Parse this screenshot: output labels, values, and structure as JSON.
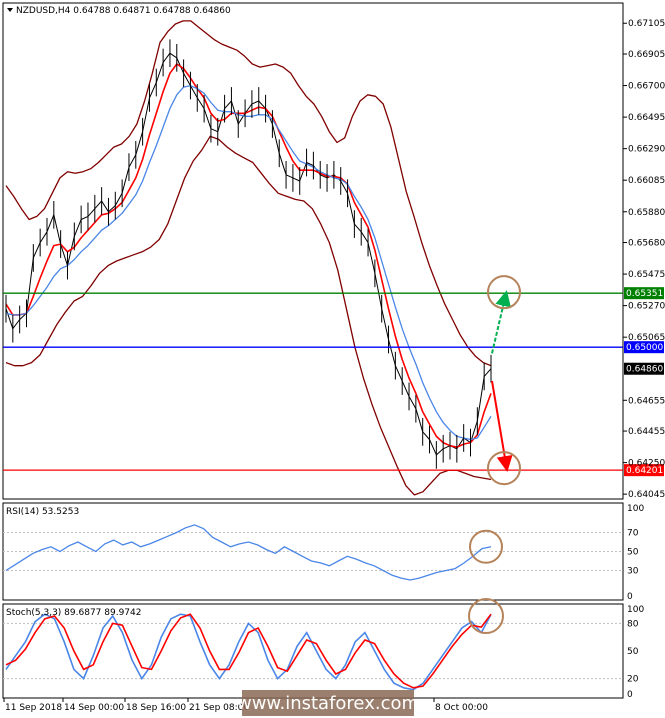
{
  "header": {
    "main": "NZDUSD,H4  0.64788 0.64871 0.64788 0.64860",
    "rsi": "RSI(14) 53.5253",
    "stoch": "Stoch(5,3,3) 89.6877 89.9742"
  },
  "watermark": "www.instaforex.com",
  "colors": {
    "price": "#000000",
    "bollinger": "#800000",
    "fast_ma": "#ff0000",
    "slow_ma": "#4a86e8",
    "level_high": "#008000",
    "level_mid": "#0000ff",
    "level_low": "#ff0000",
    "marker": "#b5835a",
    "arrow_up": "#00b050",
    "arrow_down": "#ff0000",
    "rsi_line": "#4a86e8",
    "stoch_main": "#4a86e8",
    "stoch_signal": "#ff0000"
  },
  "chart_data": [
    {
      "type": "line",
      "panel": "price",
      "symbol": "NZDUSD",
      "timeframe": "H4",
      "ylim": [
        0.6402,
        0.6723
      ],
      "y_ticks": [
        "0.67105",
        "0.66905",
        "0.66700",
        "0.66495",
        "0.66290",
        "0.66085",
        "0.65880",
        "0.65680",
        "0.65475",
        "0.65270",
        "0.65065",
        "0.64655",
        "0.64455",
        "0.64250",
        "0.64045"
      ],
      "x_ticks": [
        "11 Sep 2018",
        "14 Sep 00:00",
        "18 Sep 16:00",
        "21 Sep 08:00",
        "8 Oct 00:00"
      ],
      "levels": [
        {
          "name": "green",
          "value": 0.65351,
          "label": "0.65351"
        },
        {
          "name": "blue",
          "value": 0.65,
          "label": "0.65000"
        },
        {
          "name": "red",
          "value": 0.64201,
          "label": "0.64201"
        }
      ],
      "last_price": {
        "value": 0.6486,
        "label": "0.64860"
      },
      "series": [
        {
          "name": "price",
          "values": [
            0.6525,
            0.6512,
            0.6518,
            0.6522,
            0.6558,
            0.6568,
            0.6575,
            0.6586,
            0.6567,
            0.6553,
            0.6572,
            0.6583,
            0.6585,
            0.659,
            0.6595,
            0.6588,
            0.6592,
            0.66,
            0.6617,
            0.6625,
            0.664,
            0.6662,
            0.6672,
            0.6685,
            0.6691,
            0.6688,
            0.6678,
            0.667,
            0.6662,
            0.6655,
            0.6642,
            0.664,
            0.6655,
            0.666,
            0.6645,
            0.6652,
            0.6658,
            0.666,
            0.6655,
            0.6645,
            0.6626,
            0.6612,
            0.661,
            0.6608,
            0.662,
            0.6618,
            0.6612,
            0.661,
            0.6612,
            0.6608,
            0.66,
            0.658,
            0.6575,
            0.6568,
            0.6548,
            0.6525,
            0.6505,
            0.6488,
            0.6478,
            0.6468,
            0.646,
            0.6445,
            0.644,
            0.643,
            0.6434,
            0.6436,
            0.6434,
            0.6441,
            0.6438,
            0.6452,
            0.6481,
            0.6486
          ]
        },
        {
          "name": "fast_ma",
          "values": [
            0.6528,
            0.6521,
            0.6521,
            0.6522,
            0.6533,
            0.6545,
            0.6556,
            0.6566,
            0.6567,
            0.6562,
            0.6565,
            0.6571,
            0.6576,
            0.6581,
            0.6586,
            0.6587,
            0.659,
            0.6594,
            0.6602,
            0.661,
            0.6622,
            0.6638,
            0.6652,
            0.6666,
            0.6678,
            0.6684,
            0.6681,
            0.6675,
            0.6668,
            0.6662,
            0.6652,
            0.6647,
            0.6648,
            0.6652,
            0.6652,
            0.6652,
            0.6654,
            0.6656,
            0.6655,
            0.665,
            0.664,
            0.663,
            0.6621,
            0.6615,
            0.6615,
            0.6615,
            0.6613,
            0.6611,
            0.6611,
            0.661,
            0.6606,
            0.6594,
            0.6586,
            0.6578,
            0.6563,
            0.6544,
            0.6525,
            0.6507,
            0.6492,
            0.648,
            0.647,
            0.6458,
            0.645,
            0.6442,
            0.6438,
            0.6436,
            0.6435,
            0.6437,
            0.6438,
            0.6443,
            0.6458,
            0.647
          ]
        },
        {
          "name": "slow_ma",
          "values": [
            0.6522,
            0.6521,
            0.6521,
            0.6522,
            0.6527,
            0.6533,
            0.6539,
            0.6546,
            0.6551,
            0.6553,
            0.6557,
            0.6562,
            0.6566,
            0.6571,
            0.6576,
            0.6579,
            0.6583,
            0.6587,
            0.6593,
            0.6599,
            0.6608,
            0.662,
            0.6631,
            0.6643,
            0.6655,
            0.6664,
            0.6669,
            0.667,
            0.6668,
            0.6665,
            0.6659,
            0.6654,
            0.6653,
            0.6653,
            0.6651,
            0.665,
            0.665,
            0.6651,
            0.6651,
            0.6648,
            0.6641,
            0.6634,
            0.6627,
            0.6621,
            0.6619,
            0.6617,
            0.6614,
            0.6612,
            0.661,
            0.6609,
            0.6606,
            0.6598,
            0.6591,
            0.6583,
            0.6571,
            0.6556,
            0.6541,
            0.6526,
            0.6512,
            0.65,
            0.6489,
            0.6477,
            0.6467,
            0.6458,
            0.6451,
            0.6446,
            0.6442,
            0.6441,
            0.644,
            0.6441,
            0.6448,
            0.6455
          ]
        },
        {
          "name": "bollinger_upper",
          "values": [
            0.6605,
            0.6598,
            0.659,
            0.6583,
            0.6585,
            0.659,
            0.66,
            0.661,
            0.6614,
            0.6613,
            0.6614,
            0.6616,
            0.662,
            0.6625,
            0.663,
            0.6632,
            0.6637,
            0.6645,
            0.666,
            0.6678,
            0.6698,
            0.6705,
            0.671,
            0.6712,
            0.6712,
            0.6708,
            0.6704,
            0.67,
            0.6697,
            0.6695,
            0.6693,
            0.6689,
            0.6684,
            0.6682,
            0.6683,
            0.6684,
            0.6682,
            0.6678,
            0.667,
            0.6663,
            0.6658,
            0.665,
            0.664,
            0.6633,
            0.6636,
            0.665,
            0.666,
            0.6664,
            0.6663,
            0.6658,
            0.6643,
            0.6622,
            0.6601,
            0.6585,
            0.6568,
            0.6553,
            0.654,
            0.6528,
            0.6518,
            0.6508,
            0.65,
            0.6494,
            0.649,
            0.6488
          ]
        },
        {
          "name": "bollinger_lower",
          "values": [
            0.649,
            0.6488,
            0.6488,
            0.649,
            0.6495,
            0.6505,
            0.6515,
            0.6523,
            0.653,
            0.6533,
            0.654,
            0.6548,
            0.6553,
            0.6556,
            0.6558,
            0.656,
            0.6562,
            0.6565,
            0.657,
            0.658,
            0.6595,
            0.661,
            0.6621,
            0.6628,
            0.6637,
            0.6635,
            0.663,
            0.6626,
            0.6623,
            0.662,
            0.6613,
            0.6606,
            0.66,
            0.6598,
            0.6596,
            0.6595,
            0.659,
            0.658,
            0.6568,
            0.655,
            0.6525,
            0.65,
            0.648,
            0.6463,
            0.6448,
            0.6435,
            0.6422,
            0.641,
            0.6404,
            0.6406,
            0.6412,
            0.6418,
            0.642,
            0.642,
            0.6418,
            0.6416,
            0.6415,
            0.6414
          ]
        }
      ]
    },
    {
      "type": "line",
      "panel": "rsi",
      "title": "RSI(14) 53.5253",
      "ylim": [
        0,
        100
      ],
      "y_ticks": [
        "100",
        "70",
        "50",
        "30",
        "0"
      ],
      "series": [
        {
          "name": "RSI(14)",
          "values": [
            30,
            36,
            42,
            48,
            52,
            55,
            50,
            56,
            60,
            55,
            50,
            58,
            62,
            57,
            60,
            55,
            58,
            62,
            66,
            70,
            75,
            78,
            74,
            65,
            60,
            55,
            58,
            60,
            57,
            52,
            48,
            55,
            50,
            45,
            40,
            38,
            35,
            40,
            45,
            42,
            38,
            35,
            30,
            25,
            22,
            20,
            22,
            25,
            28,
            30,
            32,
            38,
            45,
            53,
            55
          ]
        }
      ]
    },
    {
      "type": "line",
      "panel": "stoch",
      "title": "Stoch(5,3,3) 89.6877 89.9742",
      "ylim": [
        0,
        100
      ],
      "y_ticks": [
        "100",
        "80",
        "50",
        "20",
        "0"
      ],
      "series": [
        {
          "name": "main",
          "values": [
            30,
            45,
            60,
            82,
            90,
            85,
            60,
            30,
            20,
            45,
            75,
            88,
            70,
            40,
            20,
            35,
            65,
            85,
            90,
            88,
            60,
            35,
            20,
            35,
            60,
            80,
            70,
            40,
            20,
            30,
            55,
            70,
            50,
            30,
            20,
            35,
            60,
            70,
            50,
            30,
            15,
            10,
            8,
            15,
            30,
            45,
            60,
            75,
            82,
            70,
            89.6877
          ]
        },
        {
          "name": "signal",
          "values": [
            35,
            40,
            52,
            70,
            85,
            88,
            75,
            50,
            30,
            35,
            60,
            80,
            78,
            55,
            32,
            30,
            50,
            72,
            86,
            90,
            75,
            50,
            30,
            30,
            48,
            70,
            75,
            55,
            32,
            28,
            45,
            62,
            58,
            40,
            25,
            30,
            48,
            62,
            58,
            40,
            25,
            15,
            10,
            12,
            25,
            40,
            55,
            68,
            78,
            76,
            89.9742
          ]
        }
      ]
    }
  ]
}
